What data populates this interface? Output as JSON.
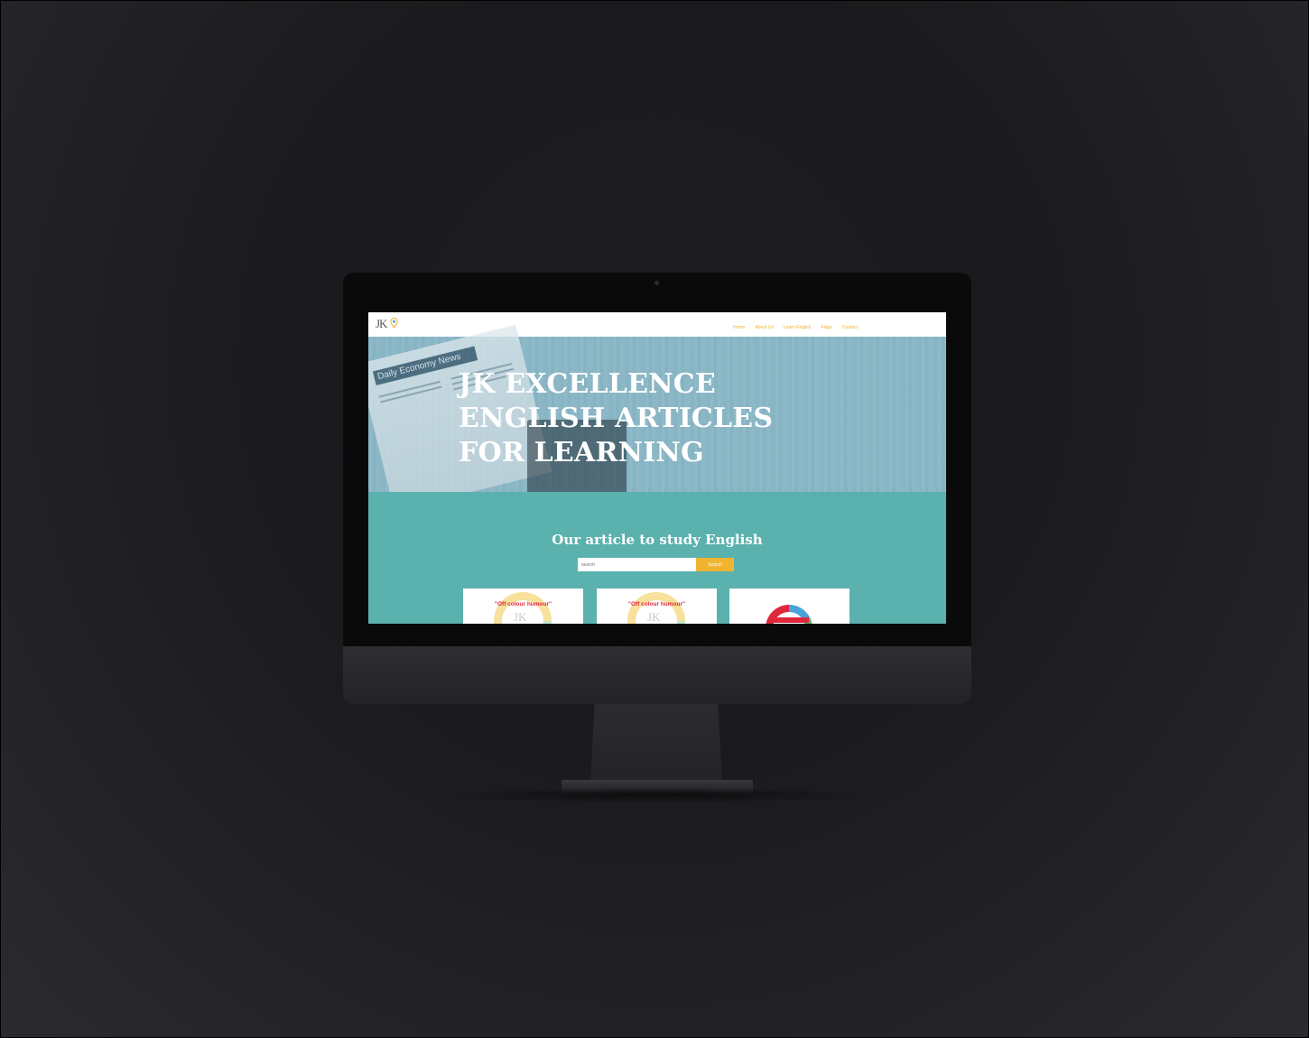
{
  "colors": {
    "page_background": "#1c1c1f",
    "nav_link": "#f0b431",
    "accent_teal": "#5ab1ae",
    "search_button": "#f0b431",
    "card_label": "#e0283c"
  },
  "site": {
    "logo_text": "JK",
    "nav": [
      "Home",
      "About Us",
      "Learn English",
      "Flags",
      "Contact"
    ]
  },
  "hero": {
    "newspaper_heading": "Daily Economy News",
    "title_lines": [
      "JK EXCELLENCE",
      "ENGLISH ARTICLES",
      "FOR LEARNING"
    ]
  },
  "articles": {
    "section_title": "Our article to study English",
    "search_placeholder": "search",
    "search_button": "Search",
    "cards": [
      {
        "label": "\"Off colour humour\"",
        "monogram": "JK"
      },
      {
        "label": "\"Off colour humour\"",
        "monogram": "JK"
      },
      {
        "label": "",
        "monogram": ""
      }
    ]
  },
  "icons": [
    "logo-pin-icon",
    "webcam-icon"
  ]
}
